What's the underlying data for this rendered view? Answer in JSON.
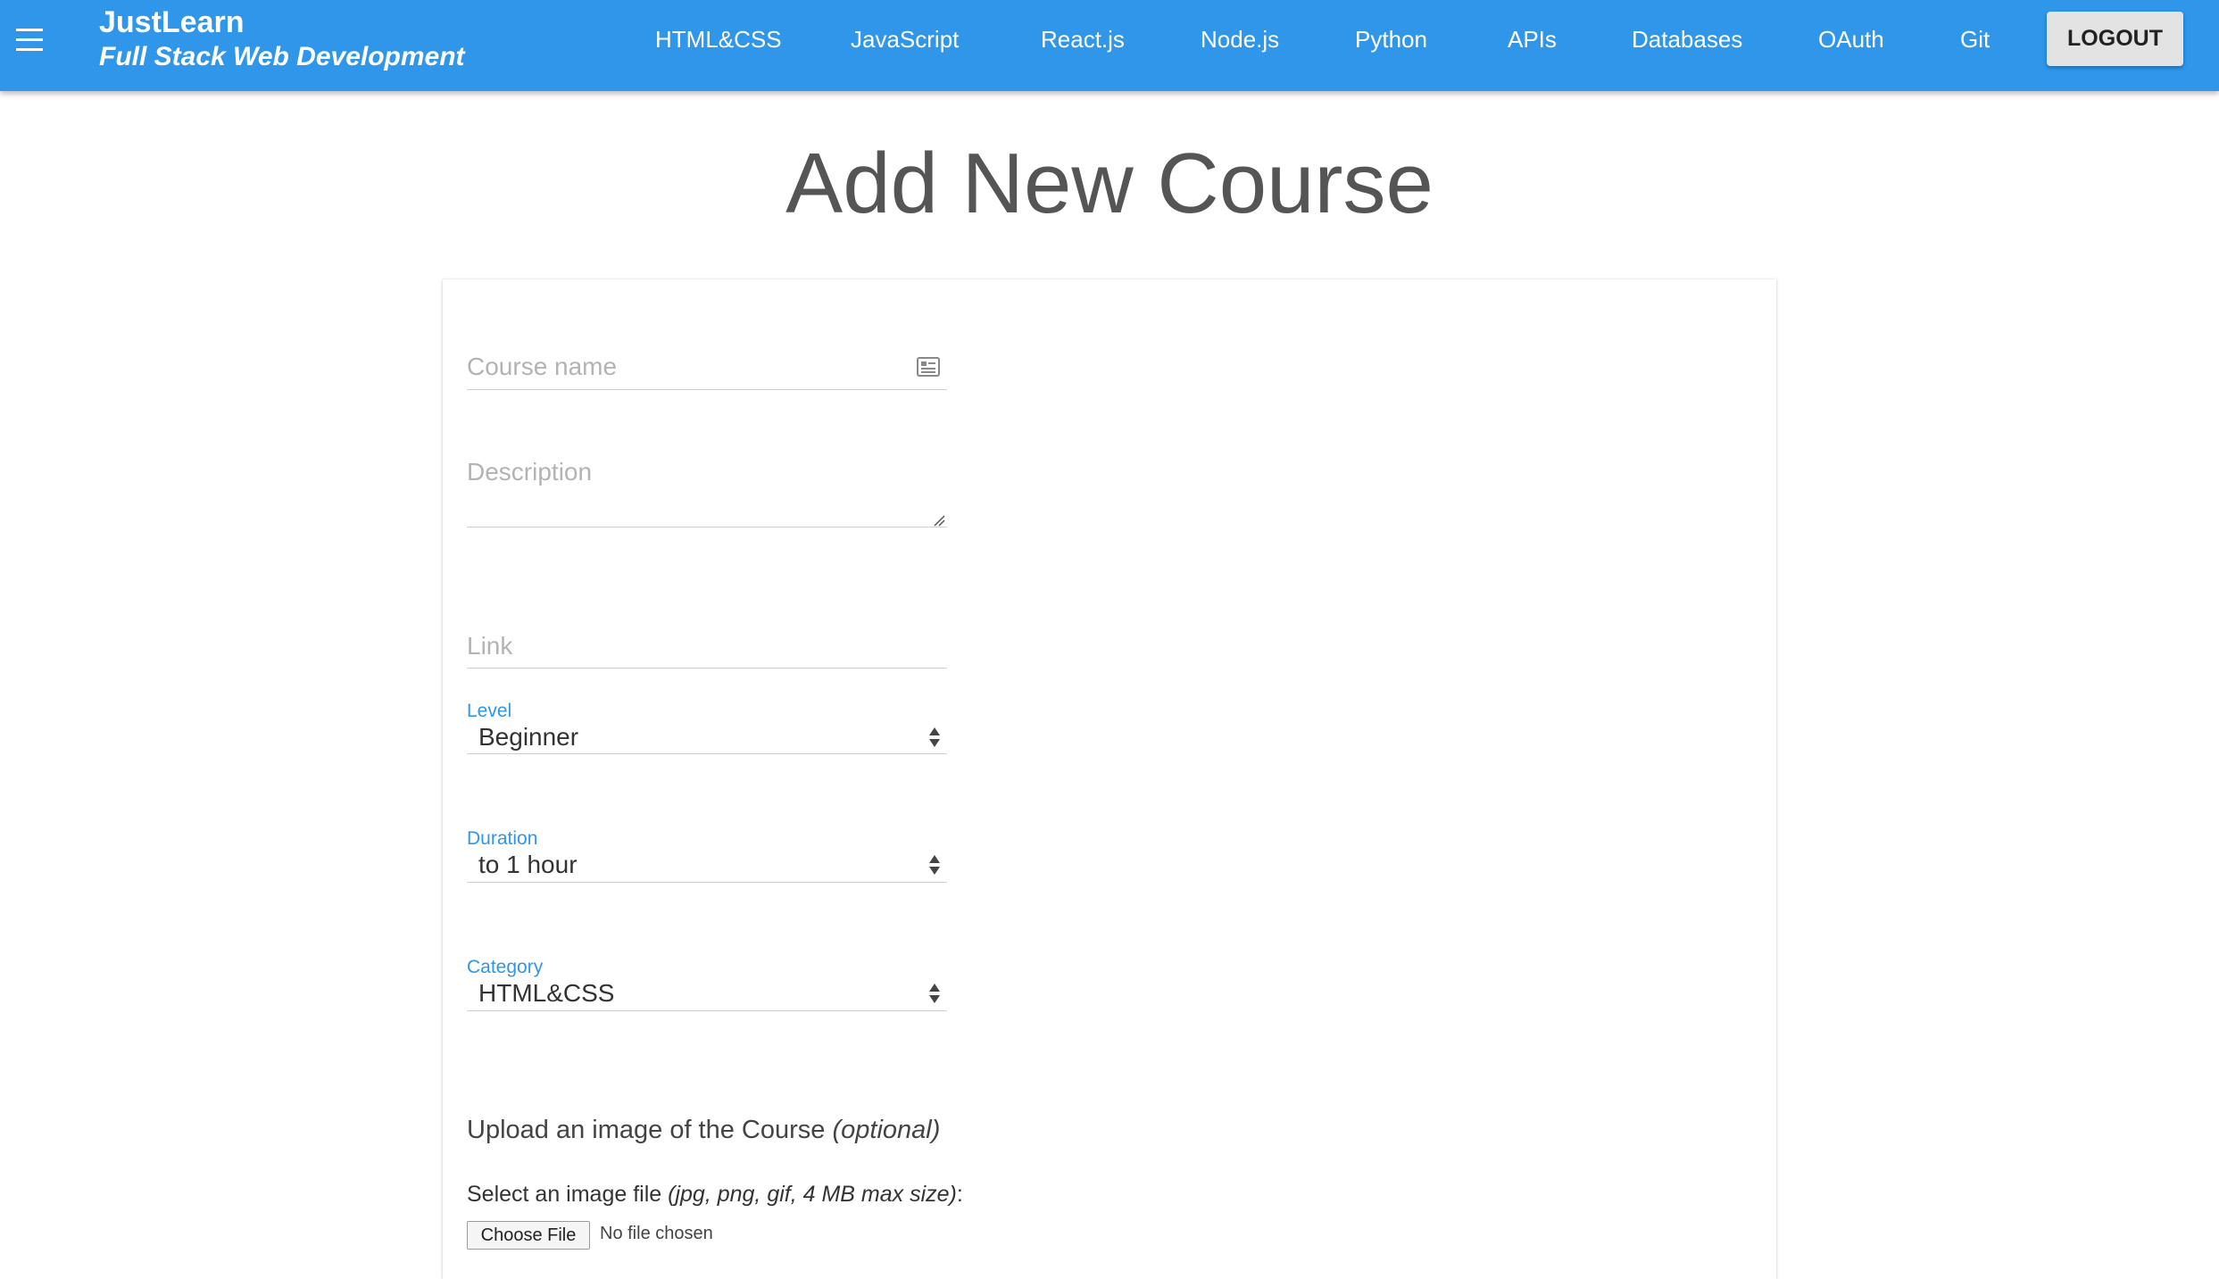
{
  "app": {
    "name": "JustLearn",
    "tagline": "Full Stack Web Development"
  },
  "nav": {
    "links": [
      {
        "label": "HTML&CSS"
      },
      {
        "label": "JavaScript"
      },
      {
        "label": "React.js"
      },
      {
        "label": "Node.js"
      },
      {
        "label": "Python"
      },
      {
        "label": "APIs"
      },
      {
        "label": "Databases"
      },
      {
        "label": "OAuth"
      },
      {
        "label": "Git"
      }
    ],
    "logout_label": "LOGOUT"
  },
  "page": {
    "title": "Add New Course"
  },
  "form": {
    "course_name": {
      "placeholder": "Course name",
      "value": "",
      "icon": "id-card-icon"
    },
    "description": {
      "placeholder": "Description",
      "value": ""
    },
    "link": {
      "placeholder": "Link",
      "value": ""
    },
    "level": {
      "label": "Level",
      "value": "Beginner"
    },
    "duration": {
      "label": "Duration",
      "value": "to 1 hour"
    },
    "category": {
      "label": "Category",
      "value": "HTML&CSS"
    },
    "upload": {
      "heading": "Upload an image of the Course",
      "heading_note": "(optional)",
      "file_label": "Select an image file",
      "file_hint": "(jpg, png, gif, 4 MB max size)",
      "file_colon": ":",
      "choose_button": "Choose File",
      "no_file_text": "No file chosen"
    }
  },
  "colors": {
    "appbar": "#2f96ea",
    "accent_label": "#2f96ea",
    "title_text": "#555555",
    "logout_bg": "#e3e3e3"
  }
}
